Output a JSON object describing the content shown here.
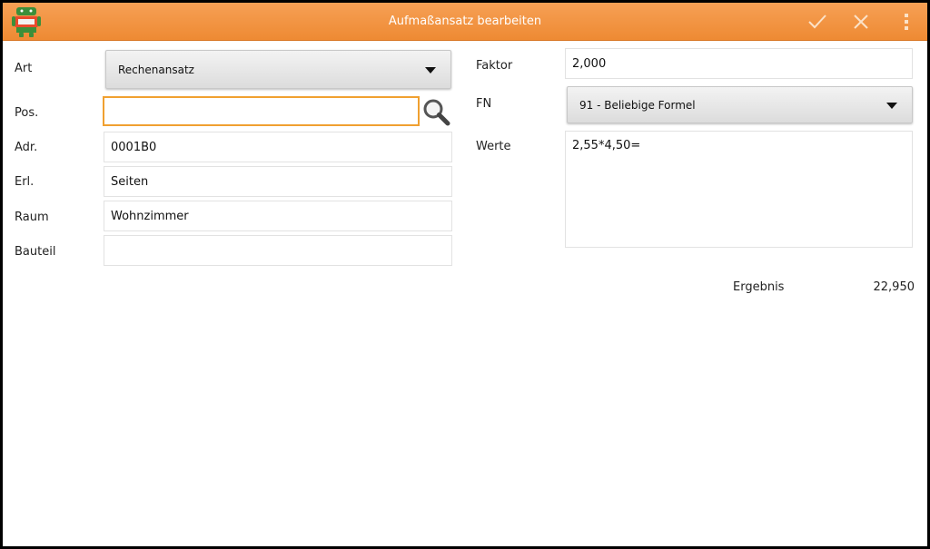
{
  "actionbar": {
    "title": "Aufmaßansatz bearbeiten",
    "app_icon": "android-app-icon",
    "confirm_icon": "checkmark-icon",
    "cancel_icon": "close-icon",
    "overflow_icon": "overflow-menu-icon",
    "color": "#ef8c36"
  },
  "left": {
    "art_label": "Art",
    "art_value": "Rechenansatz",
    "pos_label": "Pos.",
    "pos_value": "",
    "search_icon": "magnifier-icon",
    "adr_label": "Adr.",
    "adr_value": "0001B0",
    "erl_label": "Erl.",
    "erl_value": "Seiten",
    "raum_label": "Raum",
    "raum_value": "Wohnzimmer",
    "bauteil_label": "Bauteil",
    "bauteil_value": ""
  },
  "right": {
    "faktor_label": "Faktor",
    "faktor_value": "2,000",
    "fn_label": "FN",
    "fn_value": "91 - Beliebige Formel",
    "werte_label": "Werte",
    "werte_value": "2,55*4,50=",
    "ergebnis_label": "Ergebnis",
    "ergebnis_value": "22,950"
  }
}
